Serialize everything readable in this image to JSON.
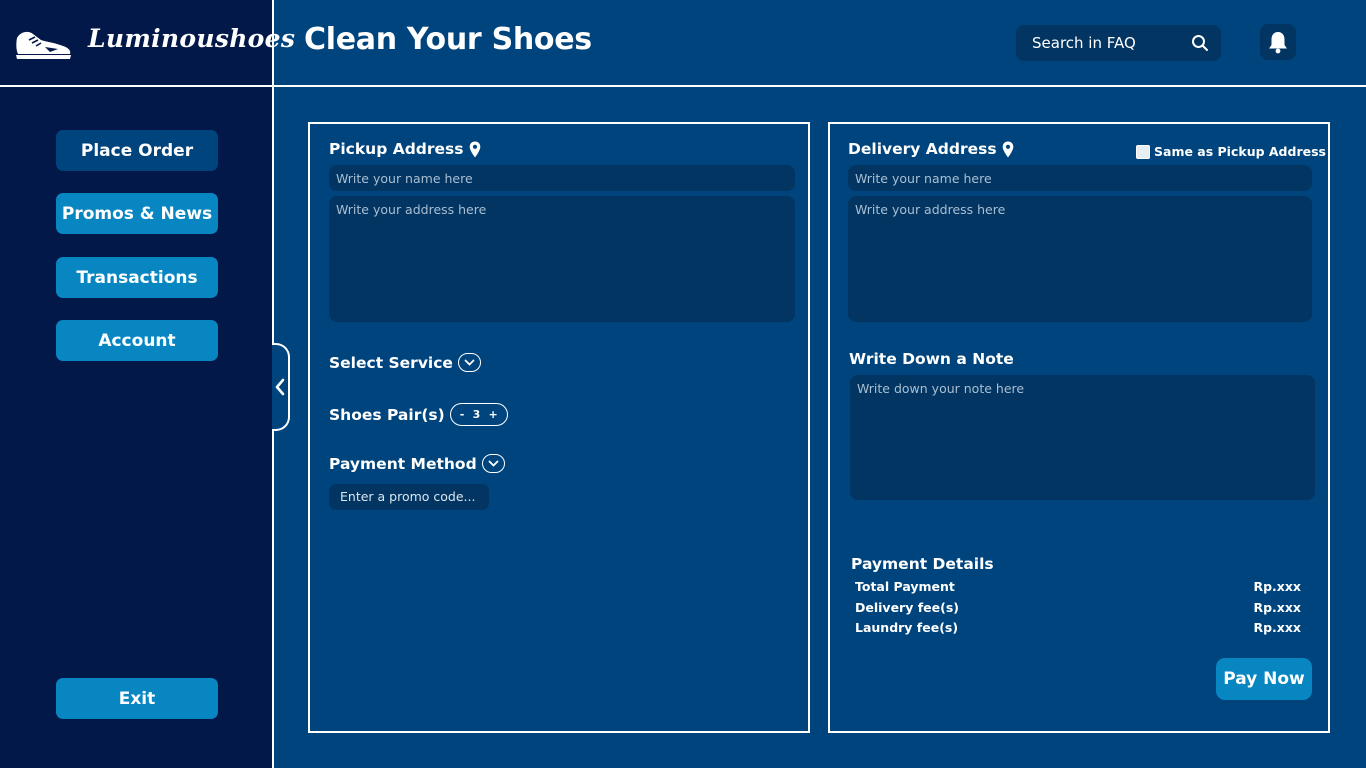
{
  "brand": {
    "name": "Luminoushoes",
    "icon": "sneaker-icon"
  },
  "header": {
    "title": "Clean Your Shoes",
    "search_placeholder": "Search in FAQ",
    "search_icon": "search-icon",
    "notification_icon": "bell-icon"
  },
  "sidebar": {
    "items": [
      {
        "label": "Place Order",
        "active": true
      },
      {
        "label": "Promos & News",
        "active": false
      },
      {
        "label": "Transactions",
        "active": false
      },
      {
        "label": "Account",
        "active": false
      }
    ],
    "exit_label": "Exit",
    "collapse_icon": "chevron-left-icon"
  },
  "pickup": {
    "label": "Pickup Address",
    "name_placeholder": "Write your name here",
    "address_placeholder": "Write your address here",
    "service_label": "Select Service",
    "pairs_label": "Shoes Pair(s)",
    "pairs": {
      "minus": "-",
      "value": "3",
      "plus": "+"
    },
    "payment_label": "Payment Method",
    "promo_placeholder": "Enter a promo code..."
  },
  "delivery": {
    "label": "Delivery Address",
    "same_as_label": "Same as Pickup Address",
    "name_placeholder": "Write your name here",
    "address_placeholder": "Write your address here",
    "note_label": "Write Down a Note",
    "note_placeholder": "Write down your note here"
  },
  "payment": {
    "title": "Payment Details",
    "rows": [
      {
        "label": "Total Payment",
        "value": "Rp.xxx"
      },
      {
        "label": "Delivery fee(s)",
        "value": "Rp.xxx"
      },
      {
        "label": "Laundry fee(s)",
        "value": "Rp.xxx"
      }
    ],
    "pay_button": "Pay Now"
  },
  "colors": {
    "background": "#00447d",
    "sidebar": "#021848",
    "input": "#023561",
    "accent": "#0786c2"
  }
}
